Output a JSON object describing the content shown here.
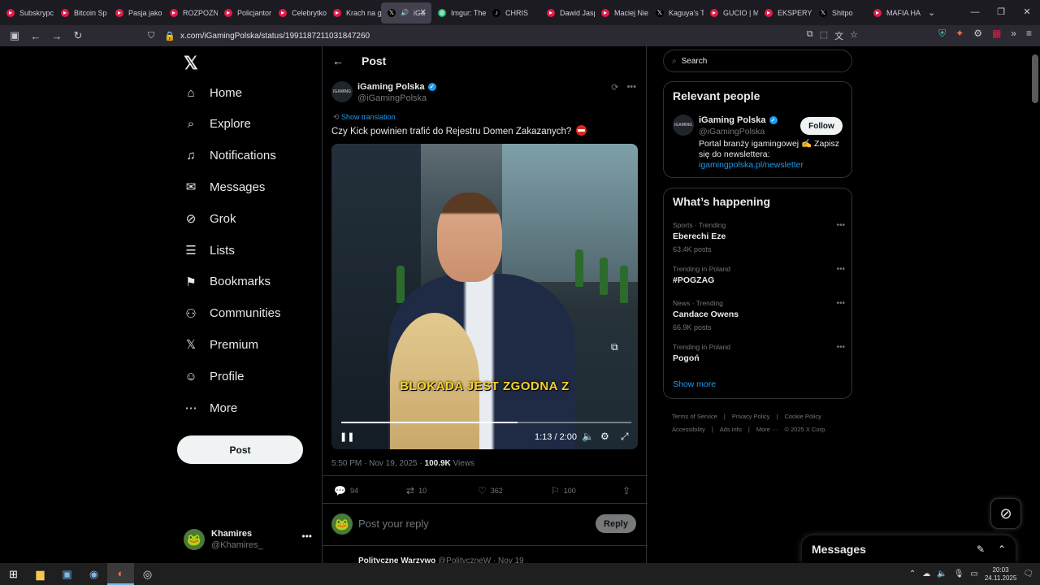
{
  "browser": {
    "tabs": [
      {
        "label": "Subskrypc",
        "color": "#e11d48",
        "icon": "youtube-icon"
      },
      {
        "label": "Bitcoin Sp",
        "color": "#e11d48",
        "icon": "youtube-icon"
      },
      {
        "label": "Pasja jako",
        "color": "#e11d48",
        "icon": "youtube-icon"
      },
      {
        "label": "ROZPOZN",
        "color": "#e11d48",
        "icon": "youtube-icon"
      },
      {
        "label": "Policjantor",
        "color": "#e11d48",
        "icon": "youtube-icon"
      },
      {
        "label": "Celebrytko",
        "color": "#e11d48",
        "icon": "youtube-icon"
      },
      {
        "label": "Krach na g",
        "color": "#e11d48",
        "icon": "youtube-icon"
      },
      {
        "label": "iGa",
        "color": "#000000",
        "icon": "x-icon",
        "active": true
      },
      {
        "label": "Imgur: The",
        "color": "#1bb76e",
        "icon": "imgur-icon"
      },
      {
        "label": "CHRIS",
        "color": "#000000",
        "icon": "tiktok-icon"
      },
      {
        "label": "Dawid Jasp",
        "color": "#e11d48",
        "icon": "youtube-icon"
      },
      {
        "label": "Maciej Nie",
        "color": "#e11d48",
        "icon": "youtube-icon"
      },
      {
        "label": "Kaguya's T",
        "color": "#000000",
        "icon": "x-icon"
      },
      {
        "label": "GUCIO | M",
        "color": "#e11d48",
        "icon": "youtube-icon"
      },
      {
        "label": "EKSPERYM",
        "color": "#e11d48",
        "icon": "youtube-icon"
      },
      {
        "label": "Shitpo",
        "color": "#000000",
        "icon": "x-icon"
      },
      {
        "label": "MAFIA HA",
        "color": "#e11d48",
        "icon": "youtube-icon"
      }
    ],
    "url": "x.com/iGamingPolska/status/1991187211031847260"
  },
  "nav": {
    "items": [
      {
        "label": "Home",
        "icon": "home-icon",
        "glyph": "⌂"
      },
      {
        "label": "Explore",
        "icon": "search-icon",
        "glyph": "⌕"
      },
      {
        "label": "Notifications",
        "icon": "bell-icon",
        "glyph": "♫"
      },
      {
        "label": "Messages",
        "icon": "mail-icon",
        "glyph": "✉"
      },
      {
        "label": "Grok",
        "icon": "grok-icon",
        "glyph": "⊘"
      },
      {
        "label": "Lists",
        "icon": "list-icon",
        "glyph": "☰"
      },
      {
        "label": "Bookmarks",
        "icon": "bookmark-icon",
        "glyph": "⚑"
      },
      {
        "label": "Communities",
        "icon": "communities-icon",
        "glyph": "⚇"
      },
      {
        "label": "Premium",
        "icon": "x-premium-icon",
        "glyph": "𝕏"
      },
      {
        "label": "Profile",
        "icon": "profile-icon",
        "glyph": "☺"
      },
      {
        "label": "More",
        "icon": "more-circle-icon",
        "glyph": "⋯"
      }
    ],
    "post_label": "Post",
    "account": {
      "name": "Khamires",
      "handle": "@Khamires_"
    }
  },
  "post": {
    "header_title": "Post",
    "author": {
      "name": "iGaming Polska",
      "handle": "@iGamingPolska"
    },
    "show_translation": "Show translation",
    "text": "Czy Kick powinien trafić do Rejestru Domen Zakazanych?",
    "video": {
      "caption": "BLOKADA JEST ZGODNA Z",
      "time": "1:13 / 2:00",
      "progress": 0.608
    },
    "timestamp": "5:50 PM · Nov 19, 2025 · ",
    "views_count": "100.9K",
    "views_label": " Views",
    "stats": {
      "replies": "94",
      "reposts": "10",
      "likes": "362",
      "bookmarks": "100"
    },
    "reply_placeholder": "Post your reply",
    "reply_button": "Reply",
    "next_post": {
      "name": "Polityczne Warzywo",
      "meta": "@PolitycznęW · Nov 19"
    }
  },
  "sidebar": {
    "search_placeholder": "Search",
    "relevant_title": "Relevant people",
    "person": {
      "name": "iGaming Polska",
      "handle": "@iGamingPolska",
      "follow": "Follow",
      "bio": "Portal branży igamingowej ✍ Zapisz się do newslettera: ",
      "link": "igamingpolska.pl/newsletter"
    },
    "happening_title": "What’s happening",
    "trends": [
      {
        "context": "Sports · Trending",
        "name": "Eberechi Eze",
        "count": "63.4K posts"
      },
      {
        "context": "Trending in Poland",
        "name": "#POGZAG",
        "count": ""
      },
      {
        "context": "News · Trending",
        "name": "Candace Owens",
        "count": "66.9K posts"
      },
      {
        "context": "Trending in Poland",
        "name": "Pogoń",
        "count": ""
      }
    ],
    "show_more": "Show more",
    "footer": [
      "Terms of Service",
      "Privacy Policy",
      "Cookie Policy",
      "Accessibility",
      "Ads info",
      "More ···",
      "© 2025 X Corp."
    ]
  },
  "messages_drawer": {
    "title": "Messages"
  },
  "taskbar": {
    "time": "20:03",
    "date": "24.11.2025"
  }
}
